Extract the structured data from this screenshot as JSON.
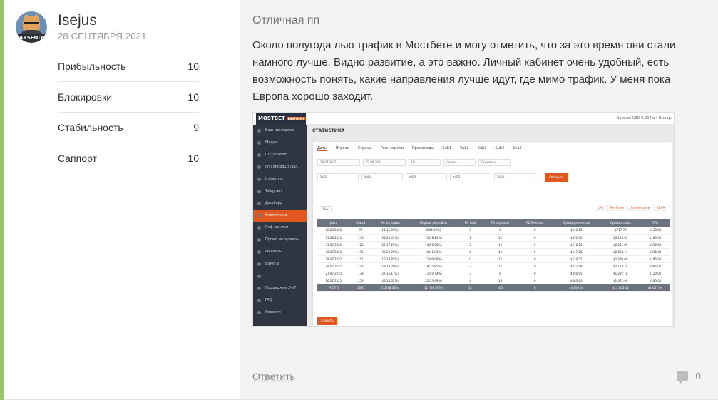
{
  "author": {
    "name": "Isejus",
    "date": "28 СЕНТЯБРЯ 2021",
    "avatar_tag": "ARSENIY"
  },
  "ratings": [
    {
      "label": "Прибыльность",
      "value": "10"
    },
    {
      "label": "Блокировки",
      "value": "10"
    },
    {
      "label": "Стабильность",
      "value": "9"
    },
    {
      "label": "Саппорт",
      "value": "10"
    }
  ],
  "review": {
    "title": "Отличная пп",
    "text": "Около полугода лью трафик в Мостбете и могу отметить, что за это время они стали намного лучше. Видно развитие, а это важно. Личный кабинет очень удобный, есть возможность понять, какие направления лучше идут, где мимо трафик. У меня пока Европа хорошо заходит."
  },
  "screenshot": {
    "logo": "MOSTBET",
    "logo_badge": "PARTNERS",
    "top_right": "Баланс: USD 0.00   Ru ▾   Выход",
    "heading": "СТАТИСТИКА",
    "sidebar": [
      {
        "label": "Ваш менеджер",
        "active": false
      },
      {
        "label": "Медия",
        "active": false
      },
      {
        "label": "Шт_mostbet",
        "active": false
      },
      {
        "label": "linn.xfd.bd1ts700...",
        "active": false
      },
      {
        "label": "Instagram",
        "active": false
      },
      {
        "label": "Telegram",
        "active": false
      },
      {
        "label": "Дашборд",
        "active": false
      },
      {
        "label": "Статистика",
        "active": true
      },
      {
        "label": "Реф. ссылки",
        "active": false
      },
      {
        "label": "Промо материалы",
        "active": false
      },
      {
        "label": "Финансы",
        "active": false
      },
      {
        "label": "Бонусы",
        "active": false
      },
      {
        "label": "",
        "active": false
      },
      {
        "label": "Поддержка 24/7",
        "active": false
      },
      {
        "label": "FAQ",
        "active": false
      },
      {
        "label": "Новости",
        "active": false
      }
    ],
    "tabs": [
      "Даты",
      "Игроки",
      "Страны",
      "Реф. ссылки",
      "Промокоды",
      "Sub1",
      "Sub2",
      "Sub3",
      "Sub4",
      "Sub5"
    ],
    "filters": [
      "29.07.2021",
      "02.09.2021",
      "LP",
      "страна",
      "Промокод"
    ],
    "filters2": [
      "Sub1",
      "Sub2",
      "Sub3",
      "Sub4",
      "Sub5"
    ],
    "apply_label": "Обновить",
    "count_label": "14 ▾",
    "actions": [
      "CPA",
      "RevShare",
      "Все колонки",
      "XLS ▾"
    ],
    "columns": [
      "Дата",
      "Клики",
      "Регистрации",
      "Первые депозиты",
      "FD hold",
      "FD approved",
      "FD Rejected",
      "Сумма депозитов",
      "Сумма ставок",
      "CPA"
    ],
    "rows": [
      [
        "02.08.2021",
        "97",
        "14(16.09%)",
        "8(84.29%)",
        "0",
        "0",
        "0",
        "$242.16",
        "$717.78",
        "$130.00"
      ],
      [
        "01.08.2021",
        "145",
        "34(23.45%)",
        "13(38.24%)",
        "1",
        "12",
        "0",
        "$631.00",
        "$3,153.65",
        "$185.00"
      ],
      [
        "31.07.2021",
        "128",
        "25(17.69%)",
        "14(56.00%)",
        "2",
        "12",
        "0",
        "$578.25",
        "$2,251.89",
        "$210.00"
      ],
      [
        "30.07.2021",
        "175",
        "39(22.29%)",
        "16(41.03%)",
        "0",
        "16",
        "0",
        "$647.28",
        "$2,624.11",
        "$235.00"
      ],
      [
        "29.07.2021",
        "101",
        "15(14.85%)",
        "12(80.00%)",
        "0",
        "12",
        "0",
        "$524.25",
        "$2,229.69",
        "$195.00"
      ],
      [
        "28.07.2021",
        "276",
        "53(19.20%)",
        "19(35.85%)",
        "2",
        "17",
        "0",
        "$747.58",
        "$2,158.10",
        "$295.00"
      ],
      [
        "27.07.2021",
        "178",
        "27(15.17%)",
        "11(40.74%)",
        "3",
        "8",
        "0",
        "$450.05",
        "$1,297.18",
        "$120.00"
      ],
      [
        "26.07.2021",
        "259",
        "45(16.62%)",
        "22(53.49%)",
        "4",
        "18",
        "0",
        "$583.00",
        "$1,472.90",
        "$290.00"
      ]
    ],
    "total": [
      "ИТОГО",
      "1360",
      "252(18.38%)",
      "117(46.80%)",
      "12",
      "105",
      "0",
      "$4,600.44",
      "$15,605.40",
      "$1,647.00"
    ],
    "export_label": "Скачать"
  },
  "footer": {
    "reply_label": "Ответить",
    "comment_count": "0"
  },
  "colors": {
    "accent_bar": "#9cc36e",
    "content_bg": "#f3f3f3",
    "mostbet_orange": "#e0581f"
  }
}
